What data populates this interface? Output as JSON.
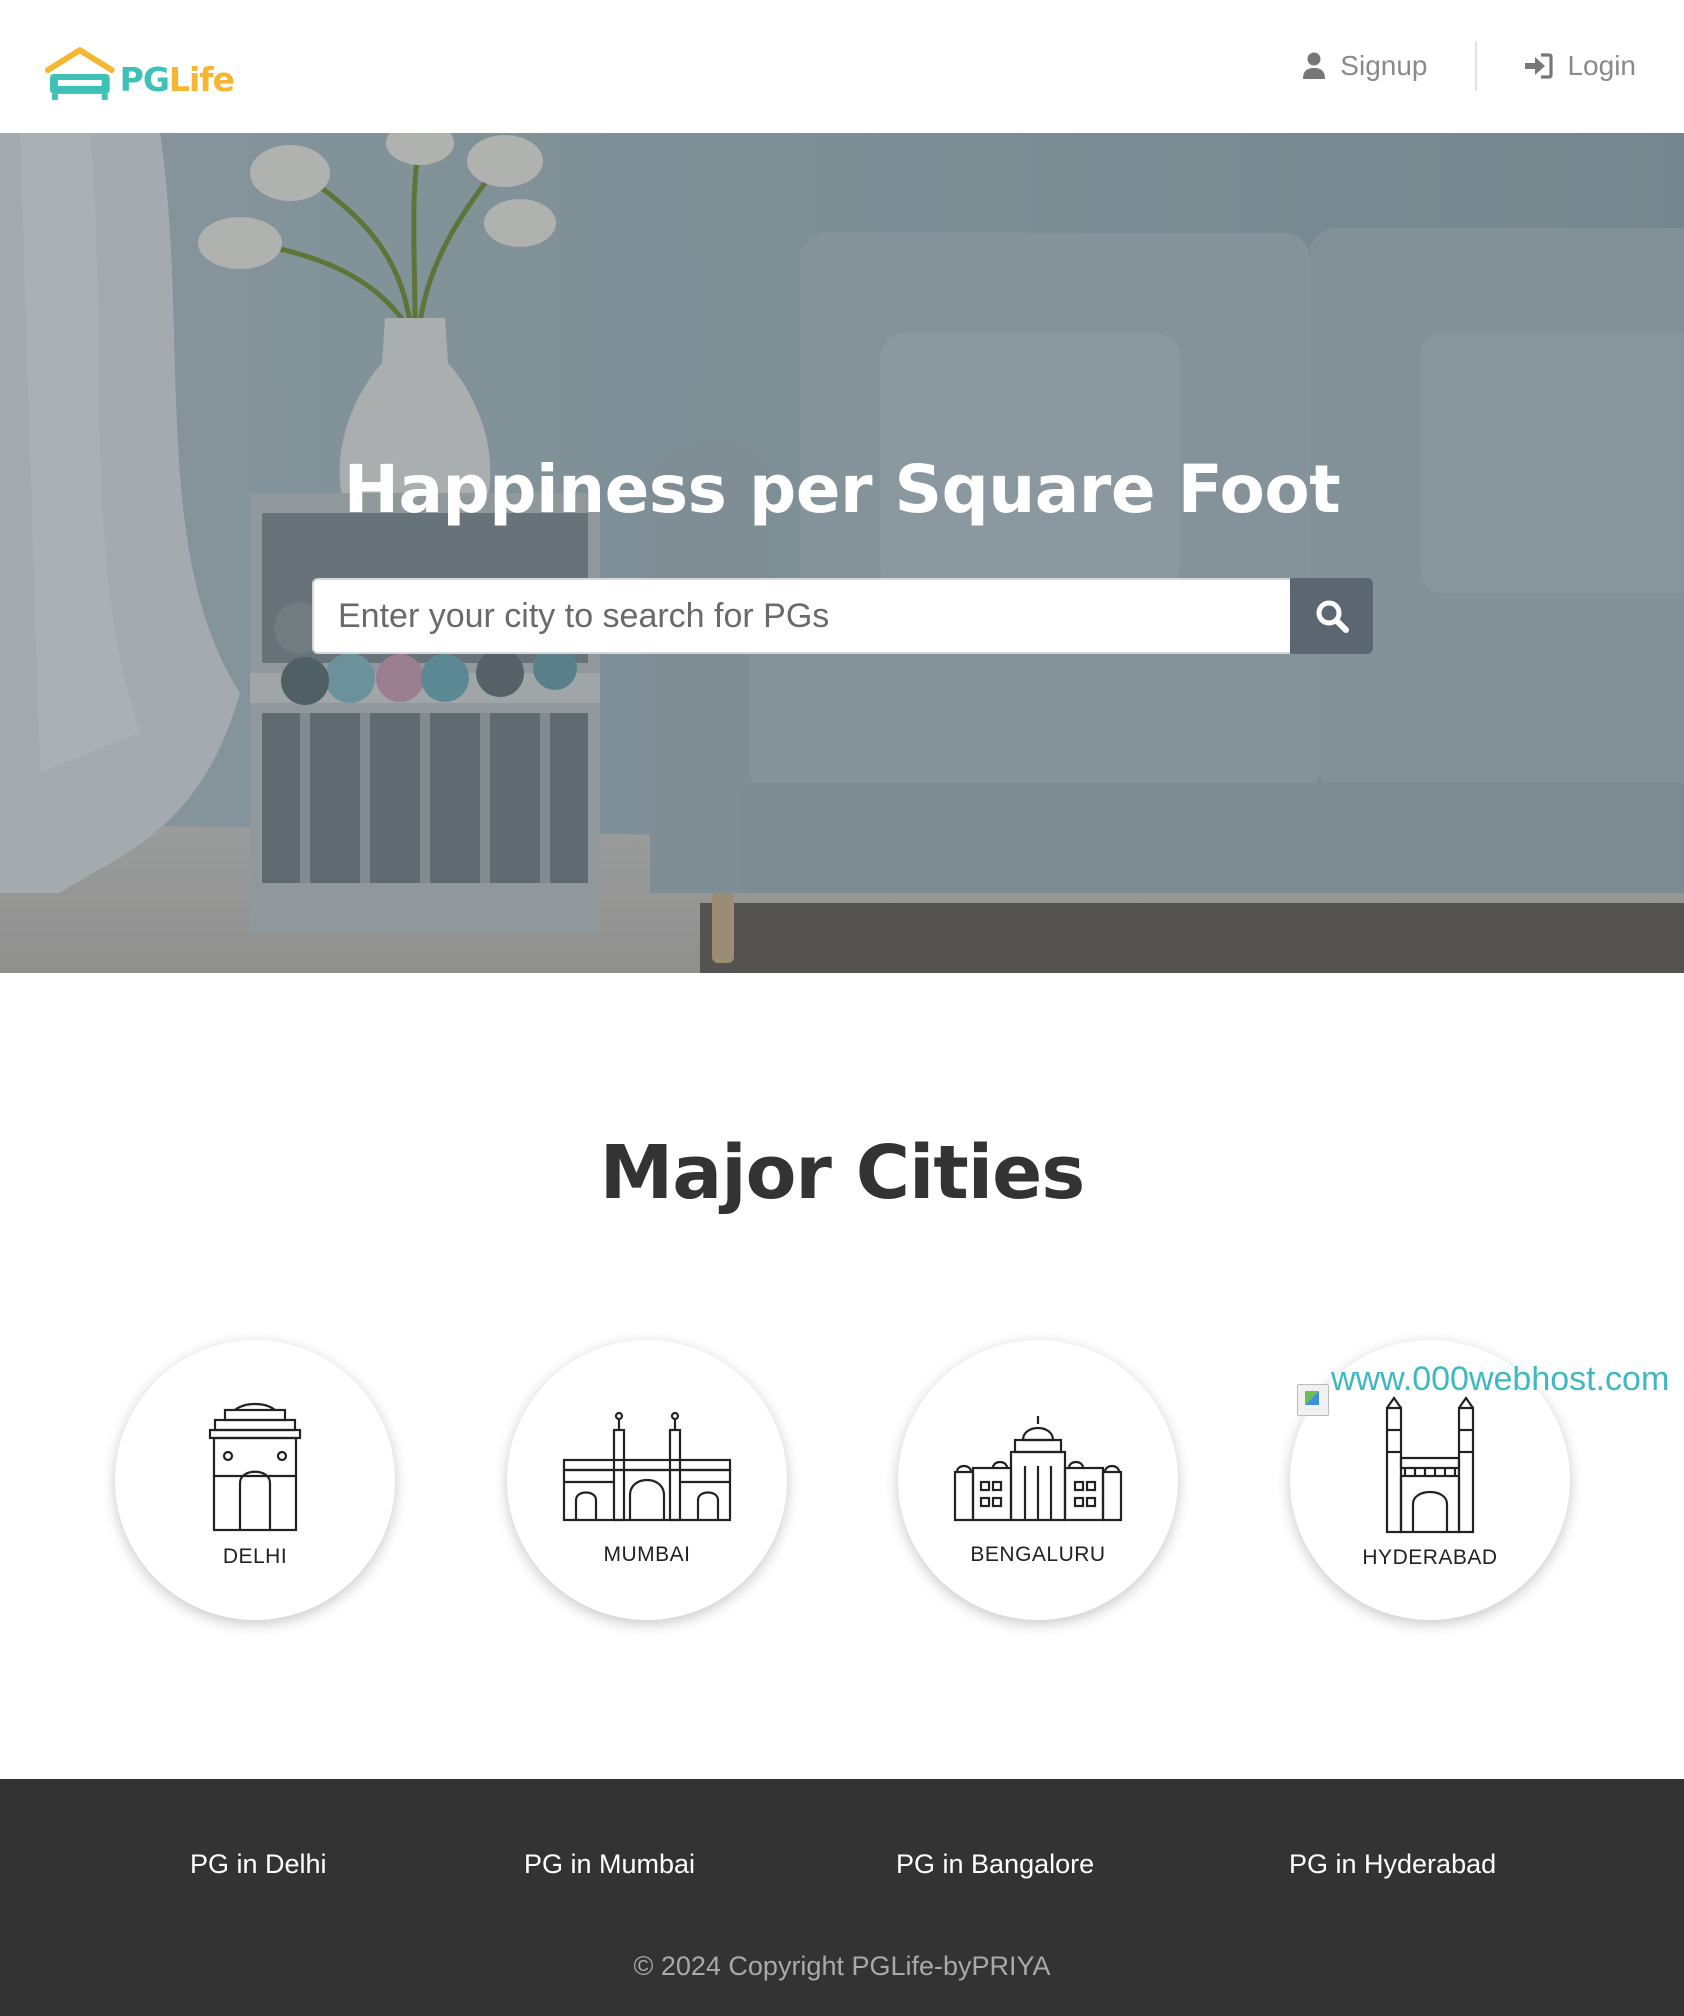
{
  "header": {
    "logo": {
      "pg": "PG",
      "life": "Life"
    },
    "nav": {
      "signup_label": "Signup",
      "login_label": "Login"
    }
  },
  "hero": {
    "title": "Happiness per Square Foot",
    "search": {
      "placeholder": "Enter your city to search for PGs",
      "value": ""
    }
  },
  "cities": {
    "title": "Major Cities",
    "items": [
      {
        "name": "DELHI",
        "icon": "india-gate-icon"
      },
      {
        "name": "MUMBAI",
        "icon": "gateway-of-india-icon"
      },
      {
        "name": "BENGALURU",
        "icon": "vidhana-soudha-icon"
      },
      {
        "name": "HYDERABAD",
        "icon": "charminar-icon"
      }
    ],
    "broken_image_alt": "www.000webhost.com"
  },
  "footer": {
    "links": [
      "PG in Delhi",
      "PG in Mumbai",
      "PG in Bangalore",
      "PG in Hyderabad"
    ],
    "copyright": "© 2024 Copyright PGLife-byPRIYA"
  },
  "colors": {
    "brand_teal": "#3fc1b5",
    "brand_yellow": "#f5b731",
    "footer_bg": "#333333",
    "search_button": "#5b6670"
  }
}
